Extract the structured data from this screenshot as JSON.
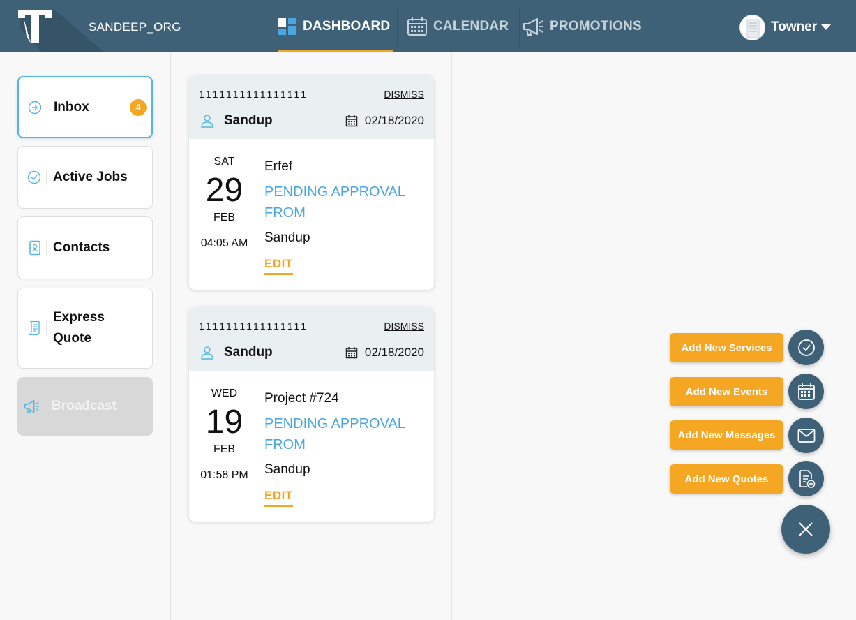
{
  "header": {
    "org_name": "SANDEEP_ORG",
    "tabs": [
      {
        "label": "DASHBOARD",
        "icon": "dashboard-icon",
        "active": true
      },
      {
        "label": "CALENDAR",
        "icon": "calendar-icon",
        "active": false
      },
      {
        "label": "PROMOTIONS",
        "icon": "megaphone-icon",
        "active": false
      }
    ],
    "user_name": "Towner"
  },
  "sidebar": {
    "items": [
      {
        "label": "Inbox",
        "icon": "arrow-circle-icon",
        "badge": "4",
        "active": true
      },
      {
        "label": "Active Jobs",
        "icon": "check-circle-icon"
      },
      {
        "label": "Contacts",
        "icon": "address-book-icon"
      },
      {
        "label": "Express Quote",
        "icon": "quote-document-icon"
      },
      {
        "label": "Broadcast",
        "icon": "megaphone-icon",
        "disabled": true
      }
    ]
  },
  "cards": [
    {
      "code": "1111111111111111",
      "dismiss": "DISMISS",
      "client": "Sandup",
      "date": "02/18/2020",
      "dow": "SAT",
      "day": "29",
      "month": "FEB",
      "time": "04:05 AM",
      "title": "Erfef",
      "status": "PENDING APPROVAL FROM",
      "from": "Sandup",
      "edit": "EDIT"
    },
    {
      "code": "1111111111111111",
      "dismiss": "DISMISS",
      "client": "Sandup",
      "date": "02/18/2020",
      "dow": "WED",
      "day": "19",
      "month": "FEB",
      "time": "01:58 PM",
      "title": "Project #724",
      "status": "PENDING APPROVAL FROM",
      "from": "Sandup",
      "edit": "EDIT"
    }
  ],
  "fab": {
    "actions": [
      {
        "label": "Add New Services",
        "icon": "check-circle-icon"
      },
      {
        "label": "Add New Events",
        "icon": "calendar-icon"
      },
      {
        "label": "Add New Messages",
        "icon": "envelope-icon"
      },
      {
        "label": "Add New Quotes",
        "icon": "add-document-icon"
      }
    ],
    "close_icon": "close-icon"
  },
  "colors": {
    "header_bg": "#3e6178",
    "accent_orange": "#f5a623",
    "status_blue": "#4aa6dd",
    "active_border": "#58b4e0",
    "card_head_bg": "#eaeff1"
  }
}
